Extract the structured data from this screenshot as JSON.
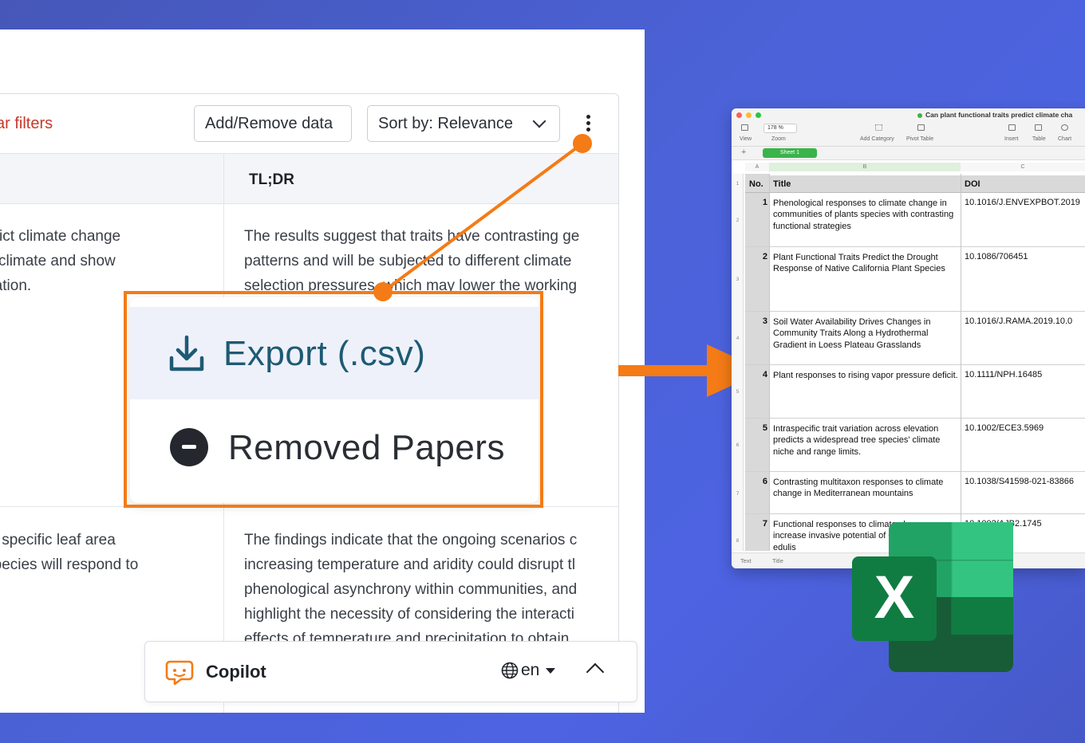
{
  "web": {
    "clear_filters": "ar filters",
    "add_remove": "Add/Remove data",
    "sort": "Sort by: Relevance",
    "col_tldr": "TL;DR",
    "row1_left": [
      "predict climate change",
      "d to climate and show",
      "rdination."
    ],
    "row1_right": [
      "The results suggest that traits have contrasting ge",
      "patterns and will be subjected to different climate",
      "selection pressures, which may lower the working"
    ],
    "row2_left": [
      "n as specific leaf area",
      "nt species will respond to"
    ],
    "row2_right": [
      "The findings indicate that the ongoing scenarios c",
      "increasing temperature and aridity could disrupt tl",
      "phenological asynchrony within communities, and",
      "highlight the necessity of considering the interacti",
      "effects of temperature and precipitation to obtain"
    ]
  },
  "menu": {
    "export": "Export (.csv)",
    "removed": "Removed Papers"
  },
  "copilot": {
    "label": "Copilot",
    "lang": "en"
  },
  "colors": {
    "accent_orange": "#f47b16",
    "export_text": "#1d5a74",
    "excel_green": "#1f7244"
  },
  "sheet": {
    "window_title": "Can plant functional traits predict climate cha",
    "zoom": "178 %",
    "toolbar": {
      "view": "View",
      "zoom": "Zoom",
      "add_category": "Add Category",
      "pivot_table": "Pivot Table",
      "insert": "Insert",
      "table": "Table",
      "chart": "Chart"
    },
    "tab": "Sheet 1",
    "col_letters": [
      "A",
      "B",
      "C"
    ],
    "headers": {
      "no": "No.",
      "title": "Title",
      "doi": "DOI"
    },
    "row_numbers": [
      "1",
      "2",
      "3",
      "4",
      "5",
      "6",
      "7",
      "8"
    ],
    "rows": [
      {
        "no": "1",
        "title": "Phenological responses to climate change in communities of plants species with contrasting functional strategies",
        "doi": "10.1016/J.ENVEXPBOT.2019"
      },
      {
        "no": "2",
        "title": "Plant Functional Traits Predict the Drought Response of Native California Plant Species",
        "doi": "10.1086/706451"
      },
      {
        "no": "3",
        "title": "Soil Water Availability Drives Changes in Community Traits Along a Hydrothermal Gradient in Loess Plateau Grasslands",
        "doi": "10.1016/J.RAMA.2019.10.0"
      },
      {
        "no": "4",
        "title": "Plant responses to rising vapor pressure deficit.",
        "doi": "10.1111/NPH.16485"
      },
      {
        "no": "5",
        "title": "Intraspecific trait variation across elevation predicts a widespread tree species' climate niche and range limits.",
        "doi": "10.1002/ECE3.5969"
      },
      {
        "no": "6",
        "title": "Contrasting multitaxon responses to climate change in Mediterranean mountains",
        "doi": "10.1038/S41598-021-83866"
      },
      {
        "no": "7",
        "title": "Functional responses to climate change may increase invasive potential of Carpobrotus edulis",
        "doi": "10.1002/AJB2.1745"
      }
    ],
    "status": {
      "left": "Text",
      "right": "Title"
    }
  },
  "excel_letter": "X"
}
